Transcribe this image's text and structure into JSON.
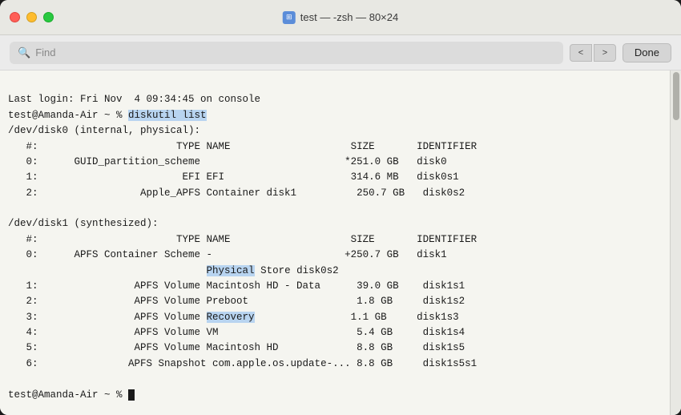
{
  "window": {
    "title": "test — -zsh — 80×24",
    "title_icon": "📁"
  },
  "search_bar": {
    "placeholder": "Find",
    "nav_prev": "<",
    "nav_next": ">",
    "done_label": "Done"
  },
  "terminal": {
    "lines": [
      "Last login: Fri Nov  4 09:34:45 on console",
      "test@Amanda-Air ~ % ",
      "/dev/disk0 (internal, physical):",
      "   #:                       TYPE NAME                    SIZE       IDENTIFIER",
      "   0:      GUID_partition_scheme                        *251.0 GB   disk0",
      "   1:                        EFI EFI                     314.6 MB   disk0s1",
      "   2:                 Apple_APFS Container disk1          250.7 GB   disk0s2",
      "",
      "/dev/disk1 (synthesized):",
      "   #:                       TYPE NAME                    SIZE       IDENTIFIER",
      "   0:      APFS Container Scheme -                      +250.7 GB   disk1",
      "                                 Physical Store disk0s2",
      "   1:                APFS Volume Macintosh HD - Data      39.0 GB    disk1s1",
      "   2:                APFS Volume Preboot                  1.8 GB     disk1s2",
      "   3:                APFS Volume Recovery                 1.1 GB     disk1s3",
      "   4:                APFS Volume VM                       5.4 GB     disk1s4",
      "   5:                APFS Volume Macintosh HD             8.8 GB     disk1s5",
      "   6:               APFS Snapshot com.apple.os.update-... 8.8 GB     disk1s5s1",
      "",
      "test@Amanda-Air ~ % "
    ]
  }
}
